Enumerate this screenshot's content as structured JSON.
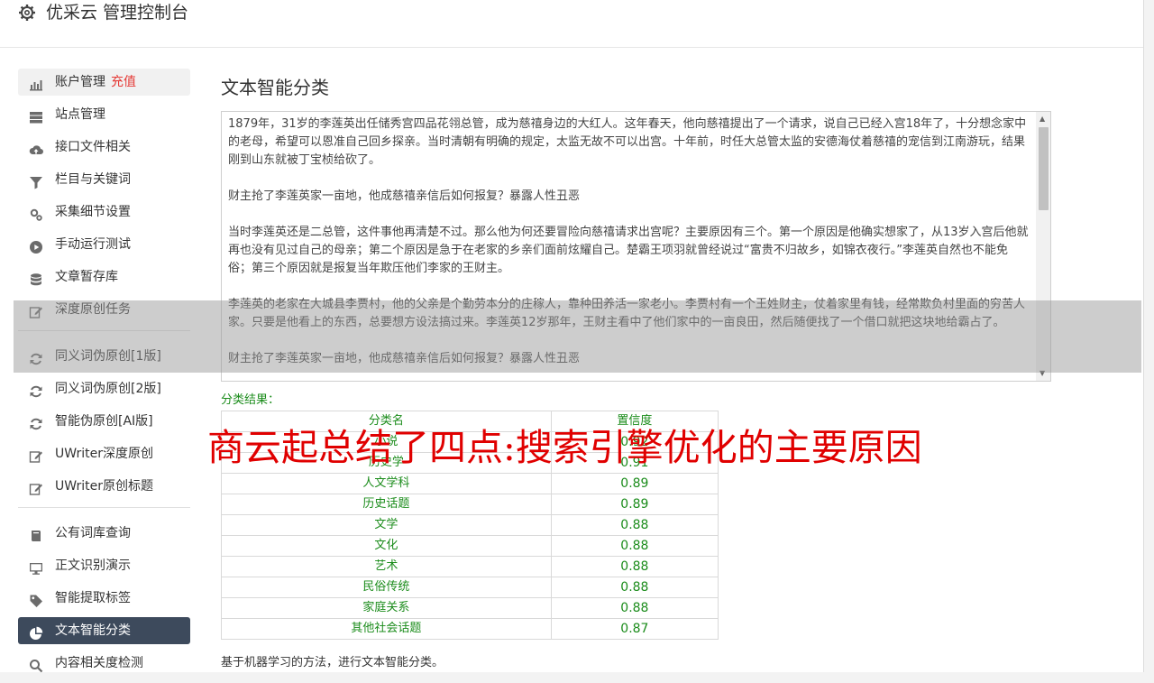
{
  "header": {
    "title": "优采云 管理控制台",
    "icon": "gear-icon"
  },
  "sidebar": {
    "groups": [
      [
        {
          "label": "账户管理",
          "extra": "充值",
          "icon": "bar-chart-icon",
          "state": "first"
        },
        {
          "label": "站点管理",
          "icon": "server-icon"
        },
        {
          "label": "接口文件相关",
          "icon": "cloud-upload-icon"
        },
        {
          "label": "栏目与关键词",
          "icon": "filter-icon"
        },
        {
          "label": "采集细节设置",
          "icon": "cogs-icon"
        },
        {
          "label": "手动运行测试",
          "icon": "play-circle-icon"
        },
        {
          "label": "文章暂存库",
          "icon": "database-icon"
        },
        {
          "label": "深度原创任务",
          "icon": "edit-icon"
        }
      ],
      [
        {
          "label": "同义词伪原创[1版]",
          "icon": "refresh-icon"
        },
        {
          "label": "同义词伪原创[2版]",
          "icon": "refresh-icon"
        },
        {
          "label": "智能伪原创[AI版]",
          "icon": "refresh-icon"
        },
        {
          "label": "UWriter深度原创",
          "icon": "edit-icon"
        },
        {
          "label": "UWriter原创标题",
          "icon": "edit-icon"
        }
      ],
      [
        {
          "label": "公有词库查询",
          "icon": "book-icon"
        },
        {
          "label": "正文识别演示",
          "icon": "monitor-icon"
        },
        {
          "label": "智能提取标签",
          "icon": "tag-icon"
        },
        {
          "label": "文本智能分类",
          "icon": "pie-chart-icon",
          "state": "active"
        },
        {
          "label": "内容相关度检测",
          "icon": "search-icon"
        }
      ]
    ]
  },
  "main": {
    "title": "文本智能分类",
    "text_paragraphs": [
      "1879年，31岁的李莲英出任储秀宫四品花翎总管，成为慈禧身边的大红人。这年春天，他向慈禧提出了一个请求，说自己已经入宫18年了，十分想念家中的老母，希望可以恩准自己回乡探亲。当时清朝有明确的规定，太监无故不可以出宫。十年前，时任大总管太监的安德海仗着慈禧的宠信到江南游玩，结果刚到山东就被丁宝桢给砍了。",
      "财主抢了李莲英家一亩地，他成慈禧亲信后如何报复？暴露人性丑恶",
      "当时李莲英还是二总管，这件事他再清楚不过。那么他为何还要冒险向慈禧请求出宫呢？主要原因有三个。第一个原因是他确实想家了，从13岁入宫后他就再也没有见过自己的母亲；第二个原因是急于在老家的乡亲们面前炫耀自己。楚霸王项羽就曾经说过“富贵不归故乡，如锦衣夜行。”李莲英自然也不能免俗；第三个原因就是报复当年欺压他们李家的王财主。",
      "李莲英的老家在大城县李贾村，他的父亲是个勤劳本分的庄稼人，靠种田养活一家老小。李贾村有一个王姓财主，仗着家里有钱，经常欺负村里面的穷苦人家。只要是他看上的东西，总要想方设法搞过来。李莲英12岁那年，王财主看中了他们家中的一亩良田，然后随便找了一个借口就把这块地给霸占了。",
      "财主抢了李莲英家一亩地，他成慈禧亲信后如何报复？暴露人性丑恶"
    ],
    "result_label": "分类结果：",
    "table": {
      "headers": [
        "分类名",
        "置信度"
      ],
      "rows": [
        [
          "小说",
          "0.92"
        ],
        [
          "历史学",
          "0.91"
        ],
        [
          "人文学科",
          "0.89"
        ],
        [
          "历史话题",
          "0.89"
        ],
        [
          "文学",
          "0.88"
        ],
        [
          "文化",
          "0.88"
        ],
        [
          "艺术",
          "0.88"
        ],
        [
          "民俗传统",
          "0.88"
        ],
        [
          "家庭关系",
          "0.88"
        ],
        [
          "其他社会话题",
          "0.87"
        ]
      ]
    },
    "footnote": "基于机器学习的方法，进行文本智能分类。"
  },
  "watermark": "商云起总结了四点:搜索引擎优化的主要原因",
  "colors": {
    "active_nav_bg": "#3d4a5c",
    "result_green": "#1b8c1b",
    "watermark_red": "#e00000",
    "recharge_red": "#e53935"
  }
}
